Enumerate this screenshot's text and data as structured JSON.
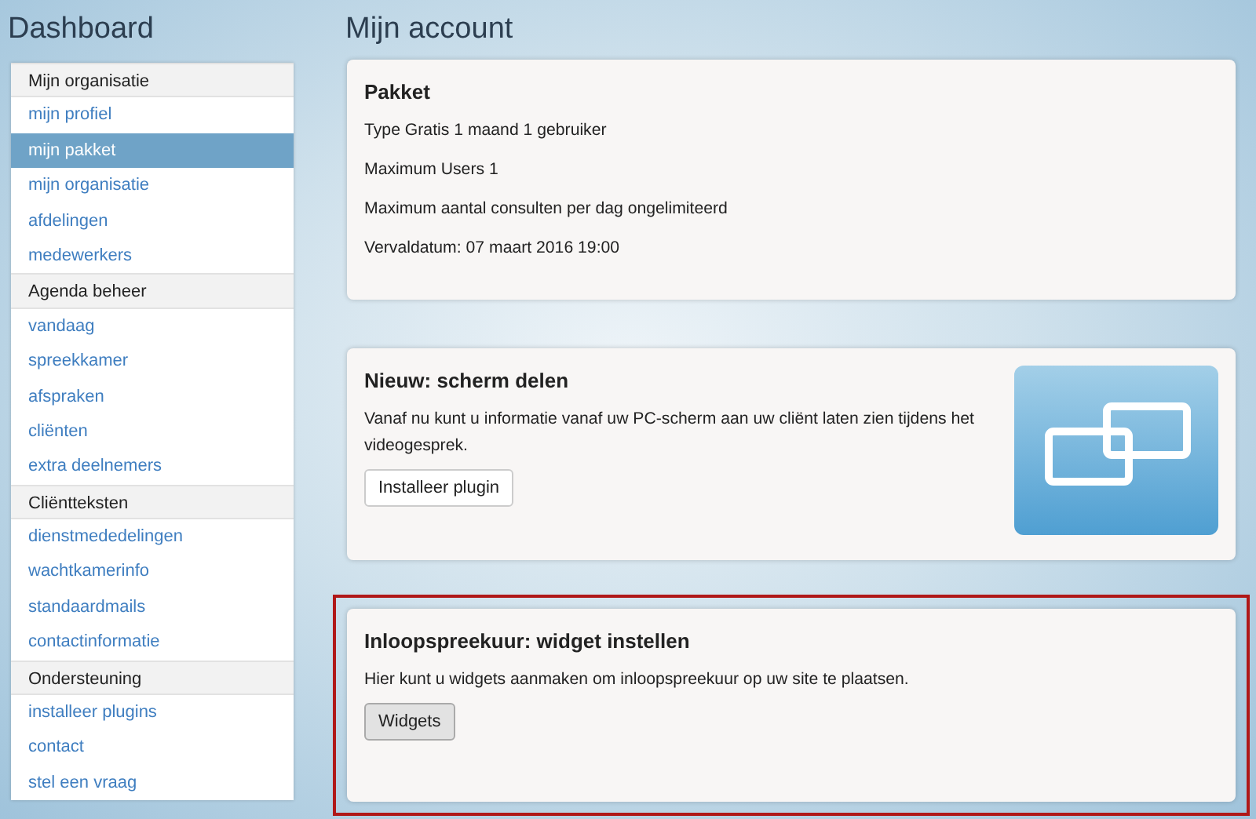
{
  "sidebar": {
    "title": "Dashboard",
    "groups": [
      {
        "heading": "Mijn organisatie",
        "items": [
          {
            "label": "mijn profiel",
            "selected": false
          },
          {
            "label": "mijn pakket",
            "selected": true
          },
          {
            "label": "mijn organisatie",
            "selected": false
          },
          {
            "label": "afdelingen",
            "selected": false
          },
          {
            "label": "medewerkers",
            "selected": false
          }
        ]
      },
      {
        "heading": "Agenda beheer",
        "items": [
          {
            "label": "vandaag",
            "selected": false
          },
          {
            "label": "spreekkamer",
            "selected": false
          },
          {
            "label": "afspraken",
            "selected": false
          },
          {
            "label": "cliënten",
            "selected": false
          },
          {
            "label": "extra deelnemers",
            "selected": false
          }
        ]
      },
      {
        "heading": "Cliëntteksten",
        "items": [
          {
            "label": "dienstmededelingen",
            "selected": false
          },
          {
            "label": "wachtkamerinfo",
            "selected": false
          },
          {
            "label": "standaardmails",
            "selected": false
          },
          {
            "label": "contactinformatie",
            "selected": false
          }
        ]
      },
      {
        "heading": "Ondersteuning",
        "items": [
          {
            "label": "installeer plugins",
            "selected": false
          },
          {
            "label": "contact",
            "selected": false
          },
          {
            "label": "stel een vraag",
            "selected": false
          }
        ]
      }
    ]
  },
  "main": {
    "title": "Mijn account",
    "cards": [
      {
        "title": "Pakket",
        "highlighted": false,
        "lines": [
          "Type Gratis 1 maand 1 gebruiker",
          "Maximum Users 1",
          "Maximum aantal consulten per dag ongelimiteerd",
          "Vervaldatum: 07 maart 2016 19:00"
        ]
      },
      {
        "title": "Nieuw: scherm delen",
        "highlighted": false,
        "lines": [
          "Vanaf nu kunt u informatie vanaf uw PC-scherm aan uw cliënt laten zien tijdens het videogesprek."
        ],
        "button": {
          "label": "Installeer plugin",
          "kind": "light"
        },
        "illustration": true
      },
      {
        "title": "Inloopspreekuur: widget instellen",
        "highlighted": true,
        "lines": [
          "Hier kunt u widgets aanmaken om inloopspreekuur op uw site te plaatsen."
        ],
        "button": {
          "label": "Widgets",
          "kind": "grey"
        }
      }
    ]
  }
}
